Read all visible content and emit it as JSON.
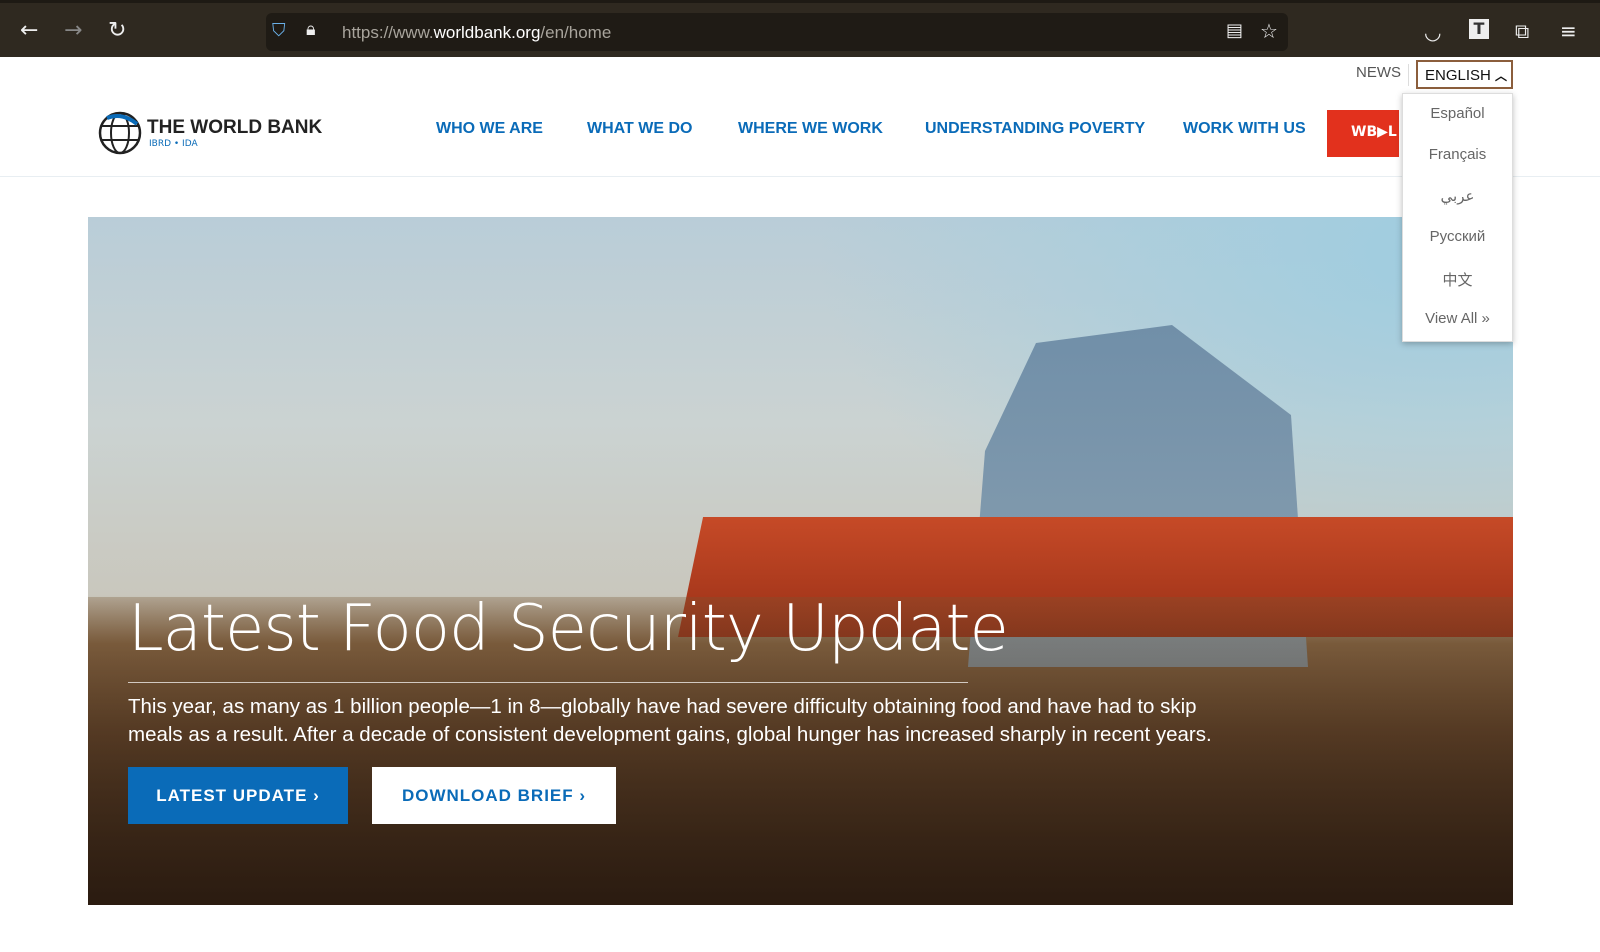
{
  "browser": {
    "url_prefix": "https://www.",
    "url_domain": "worldbank.org",
    "url_path": "/en/home",
    "back": "←",
    "forward": "→",
    "reload": "↻"
  },
  "utility": {
    "news": "NEWS",
    "language": "ENGLISH"
  },
  "logo": {
    "title": "THE WORLD BANK",
    "subtitle": "IBRD • IDA"
  },
  "nav": [
    "WHO WE ARE",
    "WHAT WE DO",
    "WHERE WE WORK",
    "UNDERSTANDING POVERTY",
    "WORK WITH US"
  ],
  "live_button": "WB▶L",
  "languages": [
    "Español",
    "Français",
    "عربي",
    "Русский",
    "中文",
    "View All »"
  ],
  "hero": {
    "title": "Latest Food Security Update",
    "description": "This year, as many as 1 billion people—1 in 8—globally have had severe difficulty obtaining food and have had to skip meals as a result. After a decade of consistent development gains, global hunger has increased sharply in recent years.",
    "primary_button": "LATEST UPDATE ›",
    "secondary_button": "DOWNLOAD BRIEF ›"
  },
  "colors": {
    "brand_blue": "#0a6bb8",
    "live_red": "#e2311d"
  }
}
